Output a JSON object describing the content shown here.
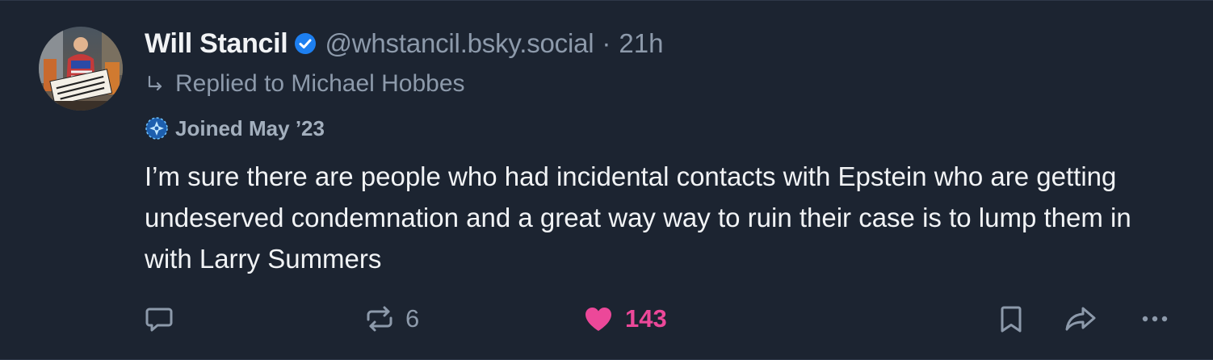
{
  "post": {
    "author": {
      "display_name": "Will Stancil",
      "handle": "@whstancil.bsky.social",
      "verified": true,
      "avatar_sign_text": "There are more of us than them"
    },
    "separator": "·",
    "time": "21h",
    "reply_to": "Replied to Michael Hobbes",
    "joined": "Joined May ’23",
    "text": "I’m sure there are people who had incidental contacts with Epstein who are getting undeserved condemnation and a great way way to ruin their case is to lump them in with Larry Summers",
    "actions": {
      "reply_count": "",
      "repost_count": "6",
      "like_count": "143",
      "liked": true
    }
  },
  "colors": {
    "background": "#1c2431",
    "text": "#f1f3f5",
    "muted": "#8d9aab",
    "verified": "#1d7ff0",
    "like": "#ec4899"
  },
  "icons": {
    "verified": "verified-check-icon",
    "reply_arrow": "reply-arrow-icon",
    "joined": "new-account-icon",
    "reply": "comment-bubble-icon",
    "repost": "repost-icon",
    "like": "heart-icon",
    "bookmark": "bookmark-icon",
    "share": "share-arrow-icon",
    "more": "more-dots-icon"
  }
}
